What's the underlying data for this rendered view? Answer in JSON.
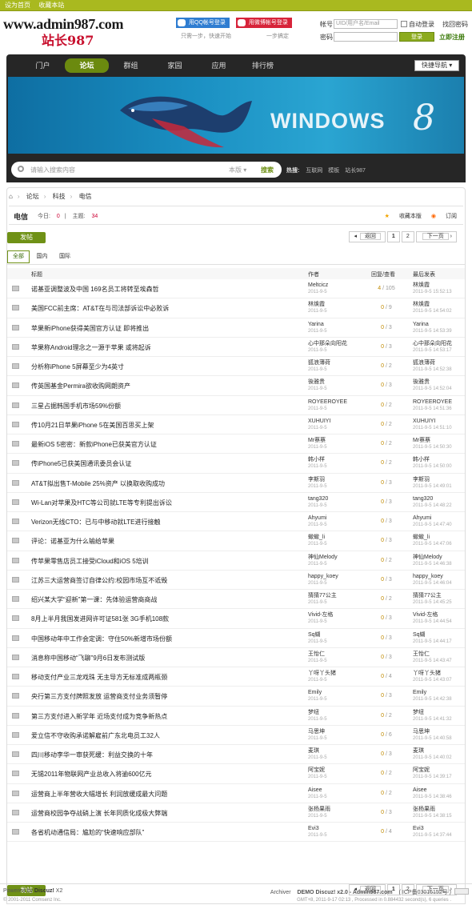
{
  "topbar": {
    "set_home": "设为首页",
    "bookmark": "收藏本站"
  },
  "header": {
    "logo_en": "www.admin987.com",
    "logo_cn": "站长987",
    "qq_login": "用QQ帐号登录",
    "weibo_login": "用微博帐号登录",
    "qq_sub": "只需一步，快速开始",
    "weibo_sub": "一步搞定",
    "login": {
      "account_label": "帐号",
      "account_placeholder": "UID/用户名/Email",
      "auto_login": "自动登录",
      "recover": "找回密码",
      "password_label": "密码",
      "submit": "登录",
      "register": "立即注册"
    }
  },
  "nav": {
    "items": [
      "门户",
      "论坛",
      "群组",
      "家园",
      "应用",
      "排行榜"
    ],
    "active_index": 1,
    "quick_nav": "快捷导航"
  },
  "banner": {
    "text": "WINDOWS",
    "digit": "8"
  },
  "search": {
    "placeholder": "请输入搜索内容",
    "scope": "本版",
    "button": "搜索",
    "hot_label": "热搜:",
    "hot": [
      "互联网",
      "模板",
      "站长987"
    ]
  },
  "breadcrumb": [
    "论坛",
    "科技",
    "电信"
  ],
  "forum": {
    "name": "电信",
    "today_label": "今日:",
    "today": "0",
    "topics_label": "主题:",
    "topics": "34",
    "favorite": "收藏本版",
    "subscribe": "订阅"
  },
  "post_button": "发帖",
  "pager": {
    "prev": "返回",
    "pages": [
      "1",
      "2"
    ],
    "next": "下一页"
  },
  "filter_tabs": [
    "全部",
    "国内",
    "国际"
  ],
  "columns": {
    "title": "标题",
    "author": "作者",
    "replies": "回复/查看",
    "last": "最后发表"
  },
  "threads": [
    {
      "title": "诺基亚调整波及中国 169名员工将转至埃森哲",
      "author": "Meltcicz",
      "date": "2011-9-5",
      "replies": "4",
      "views": "105",
      "last_user": "林焕霞",
      "last_time": "2011-9-5 15:52:13"
    },
    {
      "title": "美国FCC前主席：AT&T在与司法部诉讼中必败诉",
      "author": "林焕霞",
      "date": "2011-9-5",
      "replies": "0",
      "views": "9",
      "last_user": "林焕霞",
      "last_time": "2011-9-5 14:54:02"
    },
    {
      "title": "苹果新iPhone获得美国官方认证 即将推出",
      "author": "Yarina",
      "date": "2011-9-5",
      "replies": "0",
      "views": "3",
      "last_user": "Yarina",
      "last_time": "2011-9-5 14:53:39"
    },
    {
      "title": "苹果称Android理念之一源于苹果 或将起诉",
      "author": "心中那朵向阳花",
      "date": "2011-9-5",
      "replies": "0",
      "views": "3",
      "last_user": "心中那朵向阳花",
      "last_time": "2011-9-5 14:53:17"
    },
    {
      "title": "分析称iPhone 5屏幕至少为4英寸",
      "author": "狐浪薄荷",
      "date": "2011-9-5",
      "replies": "0",
      "views": "2",
      "last_user": "狐浪薄荷",
      "last_time": "2011-9-5 14:52:38"
    },
    {
      "title": "传英国基金Permira欲收购网朗资产",
      "author": "後雅贵",
      "date": "2011-9-5",
      "replies": "0",
      "views": "3",
      "last_user": "後雅贵",
      "last_time": "2011-9-5 14:52:04"
    },
    {
      "title": "三星占据韩国手机市场59%份额",
      "author": "ROYEEROYEE",
      "date": "2011-9-5",
      "replies": "0",
      "views": "2",
      "last_user": "ROYEEROYEE",
      "last_time": "2011-9-5 14:51:36"
    },
    {
      "title": "传10月21日苹果iPhone 5在美国百思买上架",
      "author": "XUHUIYI",
      "date": "2011-9-5",
      "replies": "0",
      "views": "2",
      "last_user": "XUHUIYI",
      "last_time": "2011-9-5 14:51:10"
    },
    {
      "title": "最新iOS 5密密：新款iPhone已获美官方认证",
      "author": "Mr蔡蔡",
      "date": "2011-9-5",
      "replies": "0",
      "views": "2",
      "last_user": "Mr蔡蔡",
      "last_time": "2011-9-5 14:50:30"
    },
    {
      "title": "传iPhone5已获美国通讯委员会认证",
      "author": "韩小样",
      "date": "2011-9-5",
      "replies": "0",
      "views": "2",
      "last_user": "韩小样",
      "last_time": "2011-9-5 14:50:00"
    },
    {
      "title": "AT&T拟出售T-Mobile 25%资产 以换取收购成功",
      "author": "李斯羽",
      "date": "2011-9-5",
      "replies": "0",
      "views": "3",
      "last_user": "李斯羽",
      "last_time": "2011-9-5 14:49:01"
    },
    {
      "title": "Wi-Lan对苹果及HTC等公司就LTE等专利提出诉讼",
      "author": "tang320",
      "date": "2011-9-5",
      "replies": "0",
      "views": "3",
      "last_user": "tang320",
      "last_time": "2011-9-5 14:48:22"
    },
    {
      "title": "Verizon无线CTO：已与中移动就LTE进行接触",
      "author": "Ahyumi",
      "date": "2011-9-5",
      "replies": "0",
      "views": "3",
      "last_user": "Ahyumi",
      "last_time": "2011-9-5 14:47:40"
    },
    {
      "title": "评论：诺基亚为什么输给苹果",
      "author": "蠍蠍_li",
      "date": "2011-9-5",
      "replies": "0",
      "views": "3",
      "last_user": "蠍蠍_li",
      "last_time": "2011-9-5 14:47:06"
    },
    {
      "title": "传苹果零售店员工接受iCloud和iOS 5培训",
      "author": "神仙Melody",
      "date": "2011-9-5",
      "replies": "0",
      "views": "2",
      "last_user": "神仙Melody",
      "last_time": "2011-9-5 14:46:38"
    },
    {
      "title": "江苏三大运营商签订自律公约:校园市场互不诋毁",
      "author": "happy_koey",
      "date": "2011-9-5",
      "replies": "0",
      "views": "3",
      "last_user": "happy_koey",
      "last_time": "2011-9-5 14:46:04"
    },
    {
      "title": "绍兴某大学“迎新”第一课：先体验运营商商战",
      "author": "猜猜77公主",
      "date": "2011-9-5",
      "replies": "0",
      "views": "2",
      "last_user": "猜猜77公主",
      "last_time": "2011-9-5 14:45:25"
    },
    {
      "title": "8月上半月我国发进网许可证581张 3G手机108款",
      "author": "Vivid-左格",
      "date": "2011-9-5",
      "replies": "0",
      "views": "3",
      "last_user": "Vivid-左格",
      "last_time": "2011-9-5 14:44:54"
    },
    {
      "title": "中国移动年中工作会定调：守住50%新增市场份额",
      "author": "Sq蝴",
      "date": "2011-9-5",
      "replies": "0",
      "views": "3",
      "last_user": "Sq蝴",
      "last_time": "2011-9-5 14:44:17"
    },
    {
      "title": "消息称中国移动“飞聊”9月6日发布测试版",
      "author": "王怡仁",
      "date": "2011-9-5",
      "replies": "0",
      "views": "3",
      "last_user": "王怡仁",
      "last_time": "2011-9-5 14:43:47"
    },
    {
      "title": "移动支付产业三龙戏珠 无主导方无标准成两瓶颈",
      "author": "丫呀丫头猪",
      "date": "2011-9-5",
      "replies": "0",
      "views": "4",
      "last_user": "丫呀丫头猪",
      "last_time": "2011-9-5 14:43:07"
    },
    {
      "title": "央行第三方支付牌照发放 运营商支付业务须暂停",
      "author": "Emily",
      "date": "2011-9-5",
      "replies": "0",
      "views": "3",
      "last_user": "Emily",
      "last_time": "2011-9-5 14:42:38"
    },
    {
      "title": "第三方支付进入新学年 近场支付成为竞争新热点",
      "author": "梦纽",
      "date": "2011-9-5",
      "replies": "0",
      "views": "2",
      "last_user": "梦纽",
      "last_time": "2011-9-5 14:41:32"
    },
    {
      "title": "爱立信不守收购承诺解雇前广东北电员工32人",
      "author": "马思坤",
      "date": "2011-9-5",
      "replies": "0",
      "views": "6",
      "last_user": "马思坤",
      "last_time": "2011-9-5 14:40:58"
    },
    {
      "title": "四川移动李华一审获死缓：利益交换的十年",
      "author": "麦琪",
      "date": "2011-9-5",
      "replies": "0",
      "views": "3",
      "last_user": "麦琪",
      "last_time": "2011-9-5 14:40:02"
    },
    {
      "title": "无锡2011年物联网产业总收入将逾600亿元",
      "author": "阿宝妮",
      "date": "2011-9-5",
      "replies": "0",
      "views": "2",
      "last_user": "阿宝妮",
      "last_time": "2011-9-5 14:39:17"
    },
    {
      "title": "运营商上半年营收大幅增长 利润放缓成最大问题",
      "author": "Aisee",
      "date": "2011-9-5",
      "replies": "0",
      "views": "2",
      "last_user": "Aisee",
      "last_time": "2011-9-5 14:38:46"
    },
    {
      "title": "运营商校园争夺战硝上演 长年同质化成极大弊端",
      "author": "张杨果雨",
      "date": "2011-9-5",
      "replies": "0",
      "views": "3",
      "last_user": "张杨果雨",
      "last_time": "2011-9-5 14:38:15"
    },
    {
      "title": "各省机动通信局：尴尬的“快速响应部队”",
      "author": "Evi3",
      "date": "2011-9-5",
      "replies": "0",
      "views": "4",
      "last_user": "Evi3",
      "last_time": "2011-9-5 14:37:44"
    }
  ],
  "footer": {
    "powered": "Powered by",
    "brand": "Discuz!",
    "version": "X2",
    "copyright": "© 2001-2011 Comsenz Inc.",
    "archiver": "Archiver",
    "site": "DEMO Discuz! x2.0 - Admin987.com",
    "icp": "( ICP备03016152号 )",
    "gmt": "GMT+8, 2011-9-17 02:13 , Processed in 0.884432 second(s), 6 queries ."
  }
}
